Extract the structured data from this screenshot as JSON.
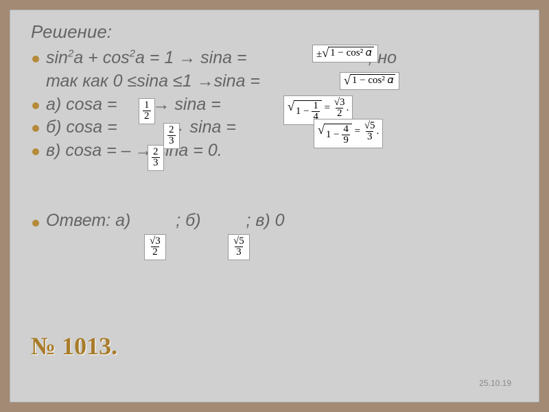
{
  "heading": "Решение:",
  "lines": {
    "l1a": "sin",
    "l1b": "a + cos",
    "l1c": "a = 1 → sina =",
    "l1d": ", но",
    "l2": "так как 0 ≤sina ≤1 →sina =",
    "l3a": "а) cosa =",
    "l3b": "→ sina =",
    "l4a": "б) cosa =",
    "l4b": "→     sina =",
    "l5a": "в) cosa = –",
    "l5b": "→ sina = 0."
  },
  "answer": {
    "label": "Ответ: а)",
    "sep1": "; б)",
    "sep2": "; в) 0"
  },
  "problem_no": "№ 1013.",
  "date": "25.10.19",
  "formulas": {
    "f1": {
      "prefix": "±",
      "under_sqrt": "1 − cos² 𝛼"
    },
    "f2": {
      "under_sqrt": "1 − cos² 𝛼"
    },
    "f3": {
      "num": "1",
      "den": "2"
    },
    "f4": {
      "under_sqrt_frac": {
        "num": "1",
        "den": "4"
      },
      "eq_num": "√3",
      "eq_den": "2"
    },
    "f5": {
      "num": "2",
      "den": "3"
    },
    "f6": {
      "under_sqrt_frac": {
        "num": "4",
        "den": "9"
      },
      "eq_num": "√5",
      "eq_den": "3"
    },
    "f7": {
      "num": "2",
      "den": "3"
    },
    "fa": {
      "num": "√3",
      "den": "2"
    },
    "fb": {
      "num": "√5",
      "den": "3"
    }
  }
}
